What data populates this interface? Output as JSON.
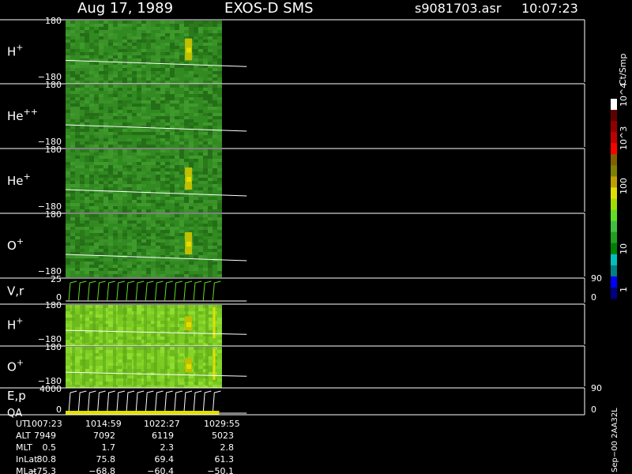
{
  "header": {
    "date": "Aug 17, 1989",
    "instrument": "EXOS-D SMS",
    "file": "s9081703.asr",
    "time": "10:07:23"
  },
  "chart_data": {
    "type": "heatmap",
    "colorbar": {
      "label": "Ct/Smp",
      "ticks": [
        "1",
        "10",
        "100",
        "10^3",
        "10^4"
      ],
      "colors": [
        "#000080",
        "#0000ff",
        "#008080",
        "#00c0c0",
        "#008000",
        "#20a020",
        "#40c040",
        "#60e020",
        "#a0e000",
        "#e0e000",
        "#c0a000",
        "#808000",
        "#806000",
        "#ff0000",
        "#c00000",
        "#900000",
        "#600000",
        "#ffffff"
      ]
    },
    "panels": [
      {
        "label": "H",
        "sup": "+",
        "ymax": "180",
        "ymin": "−180",
        "style": "dark",
        "hotspot": true
      },
      {
        "label": "He",
        "sup": "++",
        "ymax": "180",
        "ymin": "−180",
        "style": "dark",
        "hotspot": false
      },
      {
        "label": "He",
        "sup": "+",
        "ymax": "180",
        "ymin": "−180",
        "style": "dark",
        "hotspot": true
      },
      {
        "label": "O",
        "sup": "+",
        "ymax": "180",
        "ymin": "−180",
        "style": "dark",
        "hotspot": true
      },
      {
        "label": "V,r",
        "sup": "",
        "ymax": "25",
        "ymin": "0",
        "style": "line",
        "right_max": "90",
        "right_min": "0"
      },
      {
        "label": "H",
        "sup": "+",
        "ymax": "180",
        "ymin": "−180",
        "style": "light",
        "hotspot": true
      },
      {
        "label": "O",
        "sup": "+",
        "ymax": "180",
        "ymin": "−180",
        "style": "light",
        "hotspot": true
      },
      {
        "label": "E,p",
        "label2": "QA",
        "sup": "",
        "ymax": "4000",
        "ymin": "0",
        "style": "line",
        "right_max": "90",
        "right_min": "0"
      }
    ],
    "data_end_fraction": 0.296,
    "trace_end_fraction": 0.349,
    "sawtooth_count": 16
  },
  "footer": {
    "row_labels": [
      "UT",
      "ALT",
      "MLT",
      "InLat",
      "MLat"
    ],
    "columns": [
      {
        "UT": "1007:23",
        "ALT": "7949",
        "MLT": "0.5",
        "InLat": "80.8",
        "MLat": "−75.3"
      },
      {
        "UT": "1014:59",
        "ALT": "7092",
        "MLT": "1.7",
        "InLat": "75.8",
        "MLat": "−68.8"
      },
      {
        "UT": "1022:27",
        "ALT": "6119",
        "MLT": "2.3",
        "InLat": "69.4",
        "MLat": "−60.4"
      },
      {
        "UT": "1029:55",
        "ALT": "5023",
        "MLT": "2.8",
        "InLat": "61.3",
        "MLat": "−50.1"
      }
    ],
    "corner_note": "Sep−00  2AA32L"
  }
}
